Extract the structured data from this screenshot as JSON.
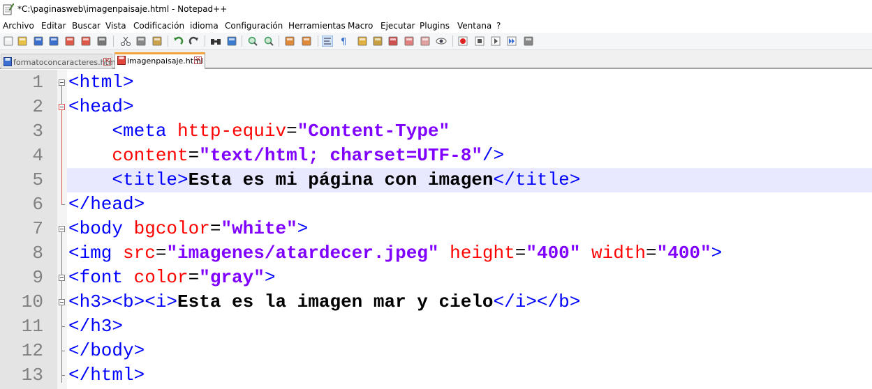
{
  "window": {
    "title": "*C:\\paginasweb\\imagenpaisaje.html - Notepad++"
  },
  "menu": [
    "Archivo",
    "Editar",
    "Buscar",
    "Vista",
    "Codificación",
    "idioma",
    "Configuración",
    "Herramientas",
    "Macro",
    "Ejecutar",
    "Plugins",
    "Ventana",
    "?"
  ],
  "toolbar": {
    "icons": [
      "new-file-icon",
      "open-file-icon",
      "save-icon",
      "save-all-icon",
      "close-icon",
      "close-all-icon",
      "print-icon",
      "cut-icon",
      "copy-icon",
      "paste-icon",
      "undo-icon",
      "redo-icon",
      "find-icon",
      "replace-icon",
      "zoom-in-icon",
      "zoom-out-icon",
      "sync-vertical-icon",
      "sync-horizontal-icon",
      "word-wrap-icon",
      "show-all-chars-icon",
      "indent-guide-icon",
      "user-lang-icon",
      "function-list-icon",
      "document-map-icon",
      "folder-workspace-icon",
      "monitor-icon",
      "record-macro-icon",
      "stop-record-icon",
      "play-macro-icon",
      "run-macro-multiple-icon",
      "save-macro-icon"
    ]
  },
  "tabs": [
    {
      "label": "formatoconcaracteres.html",
      "active": false
    },
    {
      "label": "imagenpaisaje.html",
      "active": true
    }
  ],
  "editor": {
    "current_line": 5,
    "lines": [
      {
        "n": "1",
        "seg": [
          [
            "tag",
            "<html>"
          ]
        ]
      },
      {
        "n": "2",
        "seg": [
          [
            "tag",
            "<head>"
          ]
        ]
      },
      {
        "n": "3",
        "seg": [
          [
            "eq",
            "    "
          ],
          [
            "tag",
            "<meta "
          ],
          [
            "attr",
            "http-equiv"
          ],
          [
            "eq",
            "="
          ],
          [
            "str",
            "\"Content-Type\""
          ]
        ]
      },
      {
        "n": "4",
        "seg": [
          [
            "eq",
            "    "
          ],
          [
            "attr",
            "content"
          ],
          [
            "eq",
            "="
          ],
          [
            "str",
            "\"text/html; charset=UTF-8\""
          ],
          [
            "tag",
            "/>"
          ]
        ]
      },
      {
        "n": "5",
        "seg": [
          [
            "eq",
            "    "
          ],
          [
            "tag",
            "<title>"
          ],
          [
            "txt",
            "Esta es mi página con imagen"
          ],
          [
            "tag",
            "</title>"
          ]
        ]
      },
      {
        "n": "6",
        "seg": [
          [
            "tag",
            "</head>"
          ]
        ]
      },
      {
        "n": "7",
        "seg": [
          [
            "tag",
            "<body "
          ],
          [
            "attr",
            "bgcolor"
          ],
          [
            "eq",
            "="
          ],
          [
            "str",
            "\"white\""
          ],
          [
            "tag",
            ">"
          ]
        ]
      },
      {
        "n": "8",
        "seg": [
          [
            "tag",
            "<img "
          ],
          [
            "attr",
            "src"
          ],
          [
            "eq",
            "="
          ],
          [
            "str",
            "\"imagenes/atardecer.jpeg\""
          ],
          [
            "eq",
            " "
          ],
          [
            "attr",
            "height"
          ],
          [
            "eq",
            "="
          ],
          [
            "str",
            "\"400\""
          ],
          [
            "eq",
            " "
          ],
          [
            "attr",
            "width"
          ],
          [
            "eq",
            "="
          ],
          [
            "str",
            "\"400\""
          ],
          [
            "tag",
            ">"
          ]
        ]
      },
      {
        "n": "9",
        "seg": [
          [
            "tag",
            "<font "
          ],
          [
            "attr",
            "color"
          ],
          [
            "eq",
            "="
          ],
          [
            "str",
            "\"gray\""
          ],
          [
            "tag",
            ">"
          ]
        ]
      },
      {
        "n": "10",
        "seg": [
          [
            "tag",
            "<h3><b><i>"
          ],
          [
            "txt",
            "Esta es la imagen mar y cielo"
          ],
          [
            "tag",
            "</i></b>"
          ]
        ]
      },
      {
        "n": "11",
        "seg": [
          [
            "tag",
            "</h3>"
          ]
        ]
      },
      {
        "n": "12",
        "seg": [
          [
            "tag",
            "</body>"
          ]
        ]
      },
      {
        "n": "13",
        "seg": [
          [
            "tag",
            "</html>"
          ]
        ]
      }
    ]
  }
}
